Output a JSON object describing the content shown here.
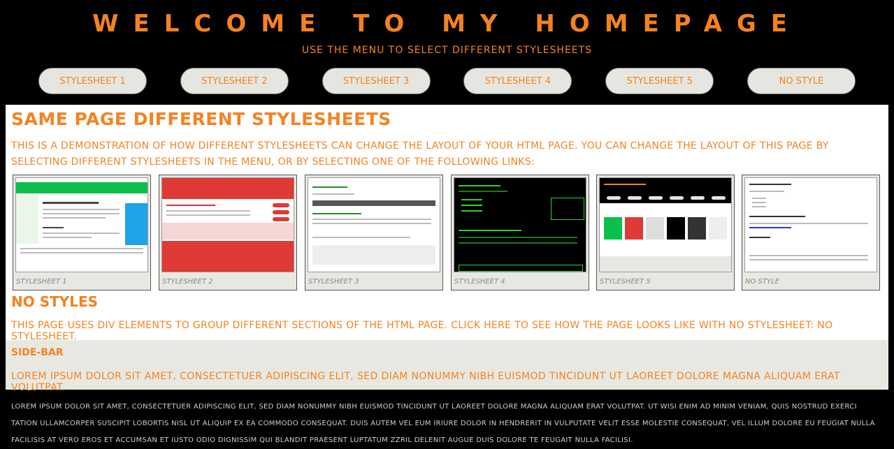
{
  "header": {
    "title": "Welcome to My Homepage",
    "subtitle": "Use the menu to select different Stylesheets"
  },
  "menu": [
    {
      "label": "Stylesheet 1"
    },
    {
      "label": "Stylesheet 2"
    },
    {
      "label": "Stylesheet 3"
    },
    {
      "label": "Stylesheet 4"
    },
    {
      "label": "Stylesheet 5"
    },
    {
      "label": "No Style"
    }
  ],
  "main": {
    "heading": "Same Page Different Stylesheets",
    "intro": "This is a demonstration of how different stylesheets can change the layout of your HTML page. You can change the layout of this page by selecting different stylesheets in the menu, or by selecting one of the following links:",
    "thumbnails": [
      {
        "caption": "Stylesheet 1"
      },
      {
        "caption": "Stylesheet 2"
      },
      {
        "caption": "Stylesheet 3"
      },
      {
        "caption": "Stylesheet 4"
      },
      {
        "caption": "Stylesheet 5"
      },
      {
        "caption": "No Style"
      }
    ],
    "nostyles_heading": "No Styles",
    "nostyles_text": "This page uses DIV elements to group different sections of the HTML page. Click here to see how the page looks like with no stylesheet:",
    "nostyles_link": "No Stylesheet."
  },
  "sidebar": {
    "heading": "Side-Bar",
    "text": "Lorem ipsum dolor sit amet, consectetuer adipiscing elit, sed diam nonummy nibh euismod tincidunt ut laoreet dolore magna aliquam erat volutpat."
  },
  "footer": {
    "text": "Lorem ipsum dolor sit amet, consectetuer adipiscing elit, sed diam nonummy nibh euismod tincidunt ut laoreet dolore magna aliquam erat volutpat. Ut wisi enim ad minim veniam, quis nostrud exerci tation ullamcorper suscipit lobortis nisl ut aliquip ex ea commodo consequat. Duis autem vel eum iriure dolor in hendrerit in vulputate velit esse molestie consequat, vel illum dolore eu feugiat nulla facilisis at vero eros et accumsan et iusto odio dignissim qui blandit praesent luptatum zzril delenit augue duis dolore te feugait nulla facilisi."
  },
  "colors": {
    "accent": "#f5821f",
    "background": "#000000",
    "panel": "#e8e8e2"
  }
}
